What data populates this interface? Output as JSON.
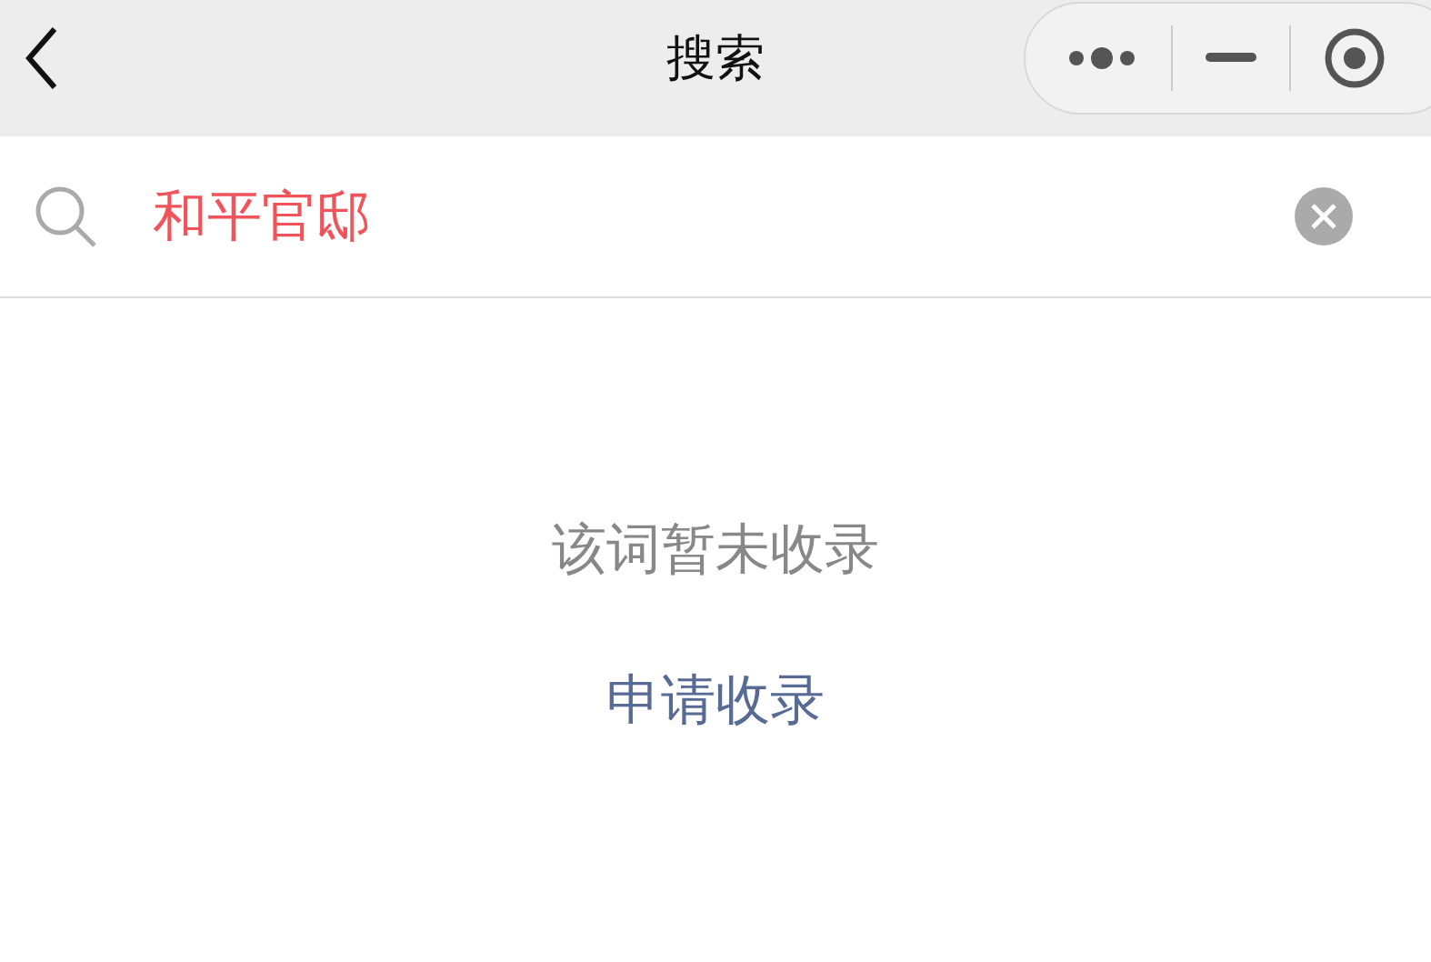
{
  "nav_bar": {
    "title": "搜索"
  },
  "search": {
    "value": "和平官邸"
  },
  "result": {
    "message": "该词暂未收录",
    "action": "申请收录"
  }
}
